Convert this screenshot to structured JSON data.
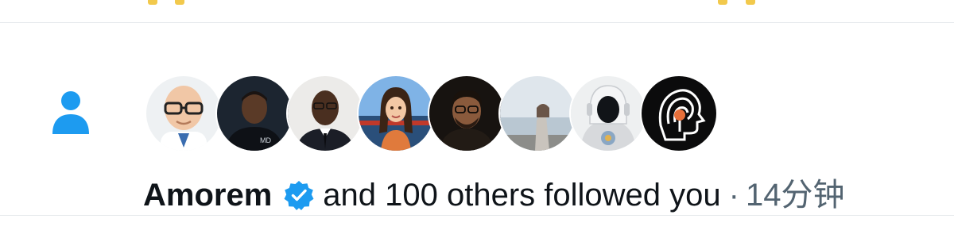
{
  "notification": {
    "type": "follow",
    "icon": "person-icon",
    "actor_name": "Amorem",
    "actor_verified": true,
    "message": "and 100 others followed you",
    "separator": "·",
    "timestamp": "14分钟",
    "avatars": [
      {
        "name": "avatar-cartoon-bald-glasses"
      },
      {
        "name": "avatar-man-dark-shirt"
      },
      {
        "name": "avatar-man-suit"
      },
      {
        "name": "avatar-cartoon-woman"
      },
      {
        "name": "avatar-man-glasses-dark"
      },
      {
        "name": "avatar-woman-seaside"
      },
      {
        "name": "avatar-astronaut-hood"
      },
      {
        "name": "avatar-maze-head-logo"
      }
    ]
  },
  "colors": {
    "accent": "#1d9bf0",
    "text": "#0f1419",
    "secondary_text": "#536471",
    "divider": "#e6e9ec"
  }
}
